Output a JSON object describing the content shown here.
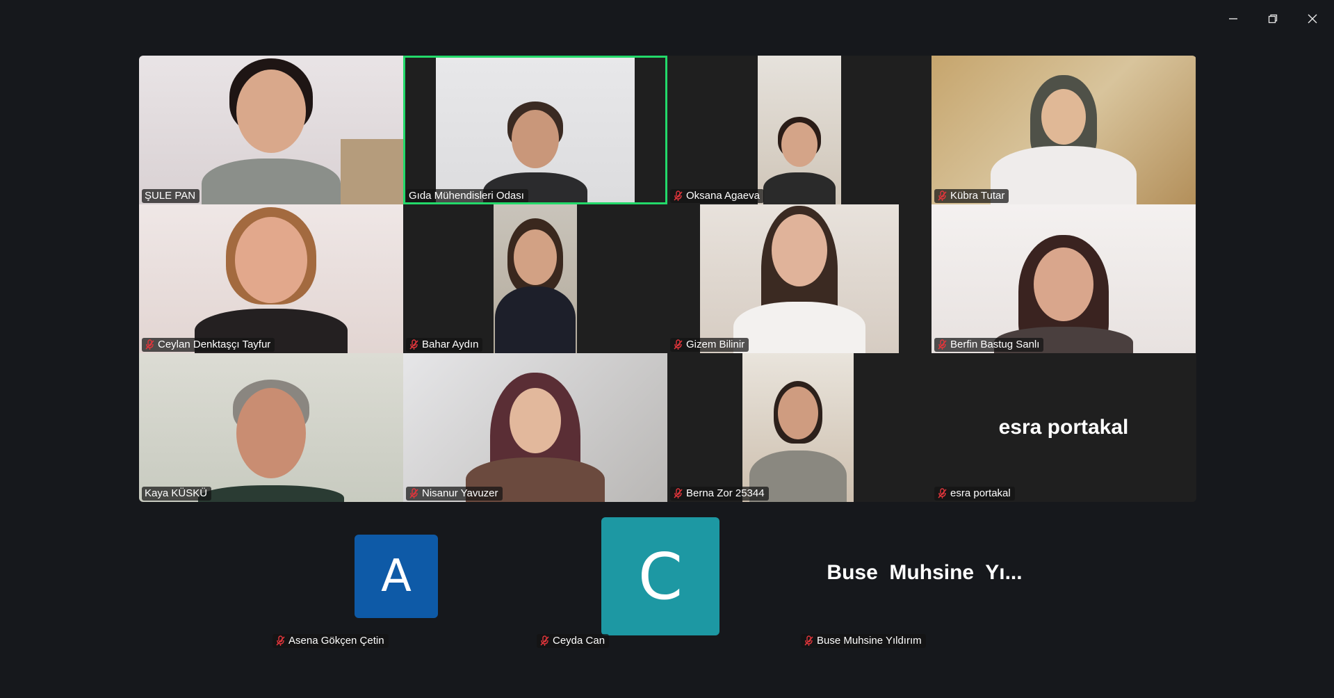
{
  "window": {
    "controls": [
      {
        "name": "minimize-icon"
      },
      {
        "name": "restore-icon"
      },
      {
        "name": "close-icon"
      }
    ]
  },
  "colors": {
    "background": "#16181c",
    "tile_background": "#1f1f1f",
    "active_speaker_border": "#23d96a",
    "mic_off_red": "#e0353b",
    "avatar_a": "#0e5aa7",
    "avatar_c": "#1d98a3"
  },
  "participants": [
    {
      "name": "ŞULE PAN",
      "muted": false
    },
    {
      "name": "Gıda Mühendisleri Odası",
      "muted": false,
      "active_speaker": true
    },
    {
      "name": "Oksana Agaeva",
      "muted": true
    },
    {
      "name": "Kübra Tutar",
      "muted": true
    },
    {
      "name": "Ceylan Denktaşçı Tayfur",
      "muted": true
    },
    {
      "name": "Bahar Aydın",
      "muted": true
    },
    {
      "name": "Gizem Bilinir",
      "muted": true
    },
    {
      "name": "Berfin Bastug Sanlı",
      "muted": true
    },
    {
      "name": "Kaya KÜSKÜ",
      "muted": false
    },
    {
      "name": "Nisanur Yavuzer",
      "muted": true
    },
    {
      "name": "Berna Zor 25344",
      "muted": true
    },
    {
      "name": "esra portakal",
      "muted": true,
      "video_off": true,
      "display_name": "esra portakal"
    }
  ],
  "bottom_participants": [
    {
      "name": "Asena Gökçen Çetin",
      "muted": true,
      "avatar_letter": "A"
    },
    {
      "name": "Ceyda Can",
      "muted": true,
      "avatar_letter": "C"
    },
    {
      "name": "Buse Muhsine Yıldırım",
      "muted": true,
      "display_name": "Buse  Muhsine  Yı..."
    }
  ]
}
